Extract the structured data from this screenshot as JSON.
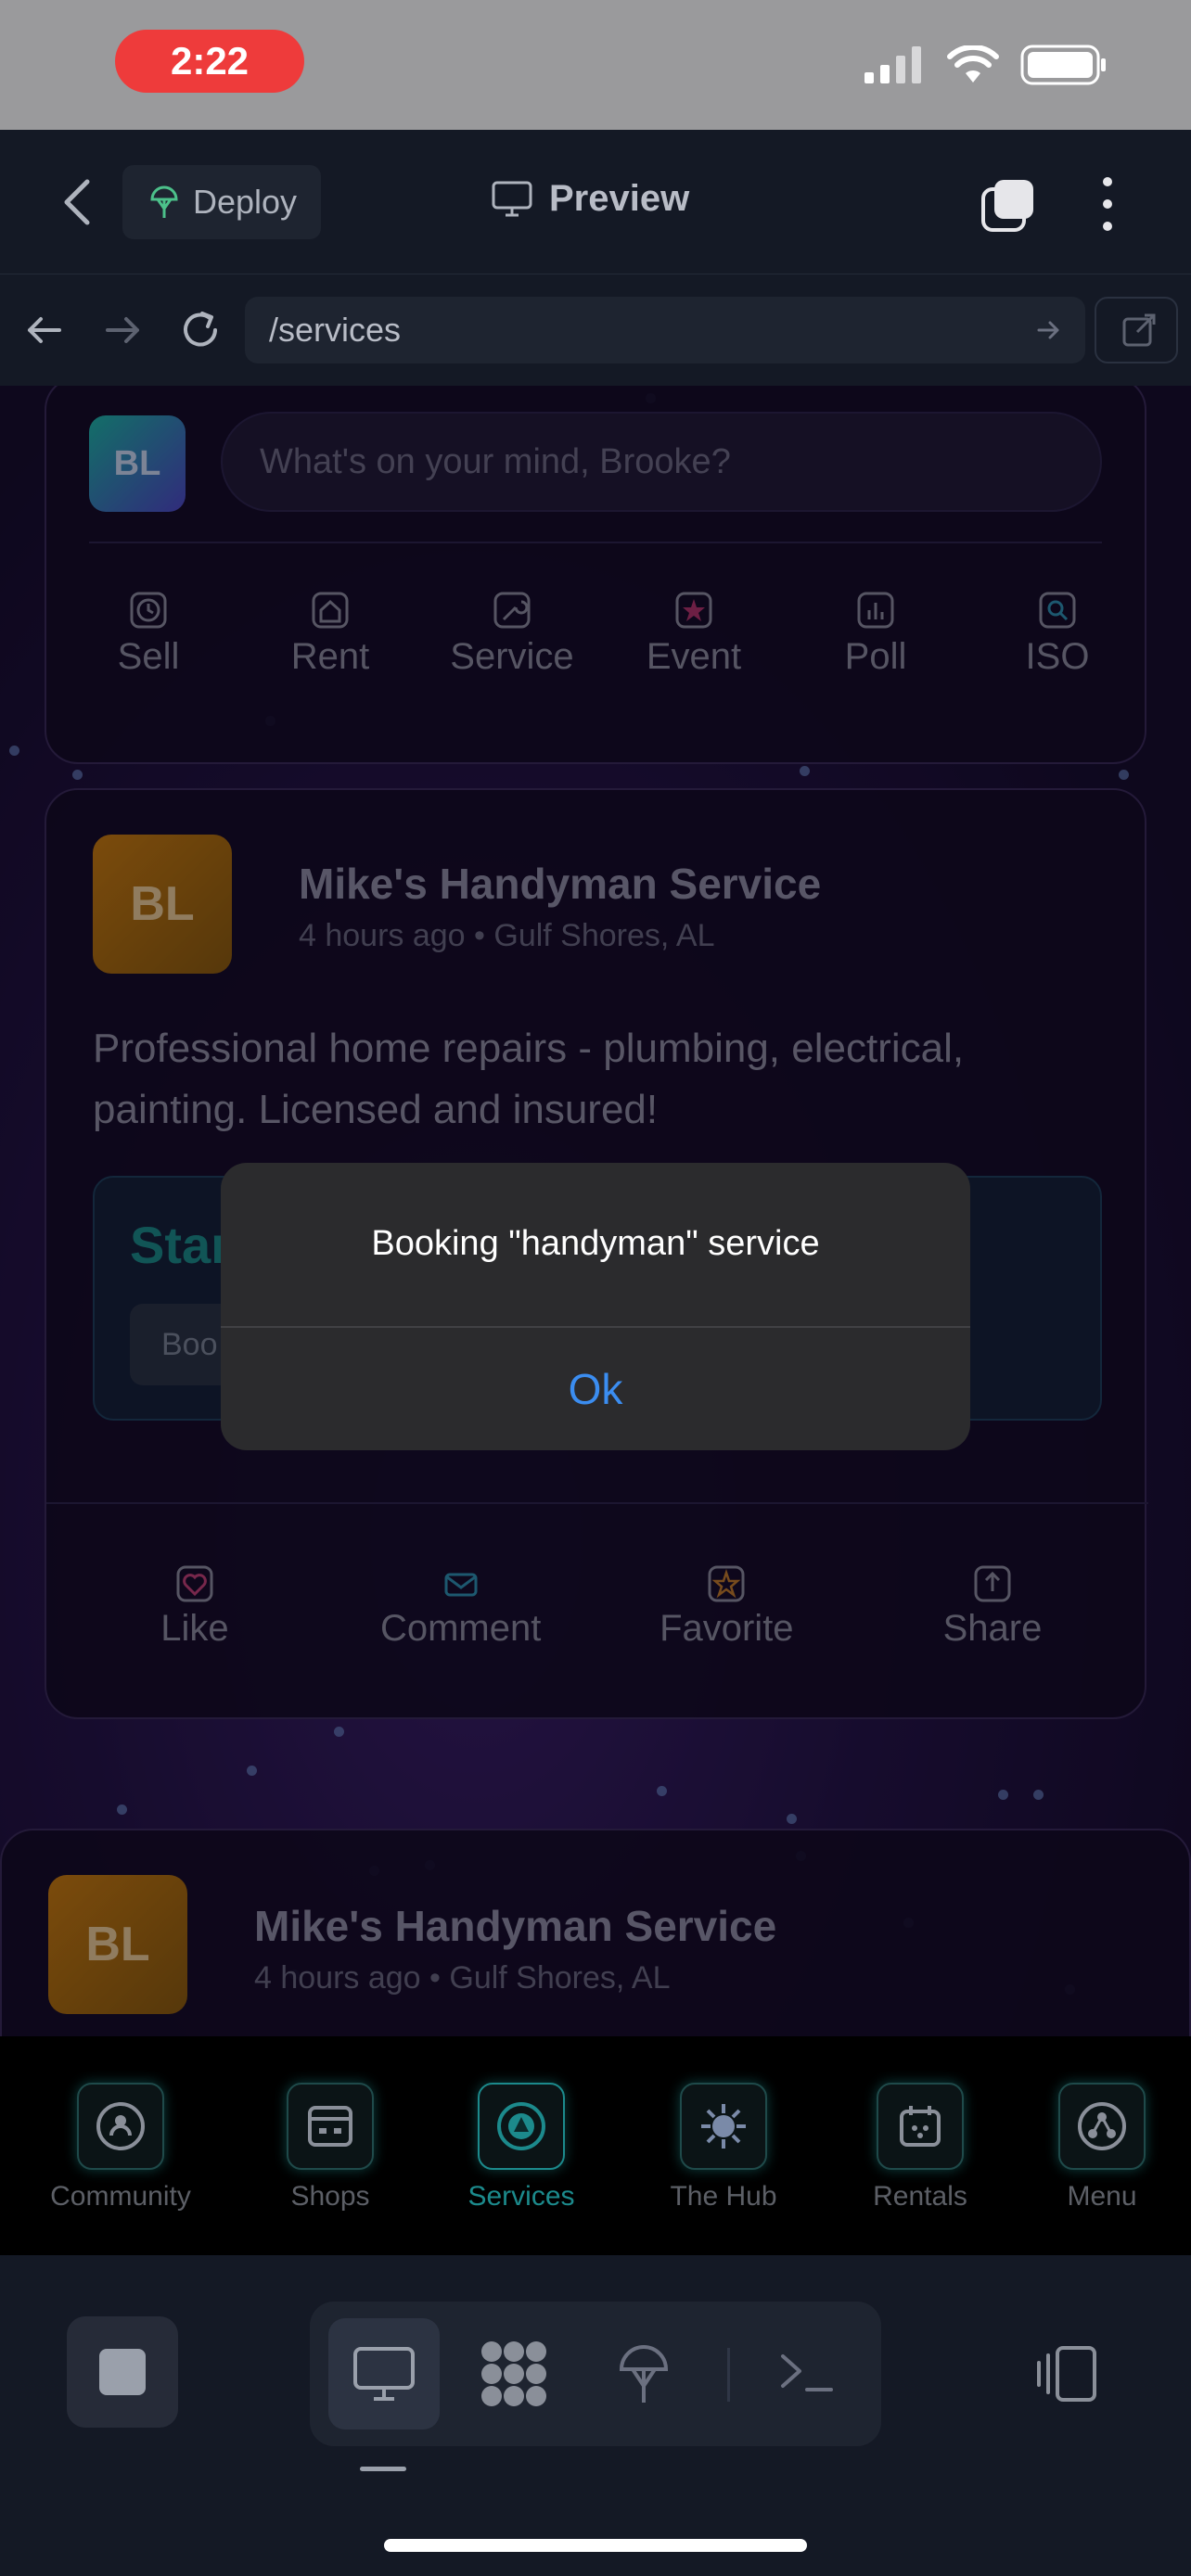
{
  "status_bar": {
    "time": "2:22"
  },
  "app_bar": {
    "deploy_label": "Deploy",
    "preview_label": "Preview"
  },
  "browser": {
    "url": "/services"
  },
  "composer": {
    "avatar_initials": "BL",
    "placeholder": "What's on your mind, Brooke?",
    "actions": [
      {
        "label": "Sell",
        "icon": "clock-icon"
      },
      {
        "label": "Rent",
        "icon": "home-icon"
      },
      {
        "label": "Service",
        "icon": "wrench-icon"
      },
      {
        "label": "Event",
        "icon": "star-icon"
      },
      {
        "label": "Poll",
        "icon": "bar-chart-icon"
      },
      {
        "label": "ISO",
        "icon": "search-icon"
      }
    ]
  },
  "post": {
    "avatar_initials": "BL",
    "name": "Mike's Handyman Service",
    "meta": "4 hours ago • Gulf Shores, AL",
    "body": "Professional home repairs - plumbing, electrical, painting. Licensed and insured!",
    "service_title": "Star",
    "service_button": "Boo",
    "reactions": [
      {
        "label": "Like",
        "icon": "heart-icon"
      },
      {
        "label": "Comment",
        "icon": "mail-icon"
      },
      {
        "label": "Favorite",
        "icon": "star-icon"
      },
      {
        "label": "Share",
        "icon": "share-icon"
      }
    ]
  },
  "post2": {
    "avatar_initials": "BL",
    "name": "Mike's Handyman Service",
    "meta": "4 hours ago • Gulf Shores, AL"
  },
  "tabbar": {
    "tabs": [
      {
        "label": "Community",
        "icon": "community-icon"
      },
      {
        "label": "Shops",
        "icon": "shop-icon"
      },
      {
        "label": "Services",
        "icon": "services-icon",
        "active": true
      },
      {
        "label": "The Hub",
        "icon": "hub-icon"
      },
      {
        "label": "Rentals",
        "icon": "rentals-icon"
      },
      {
        "label": "Menu",
        "icon": "menu-icon"
      }
    ]
  },
  "alert": {
    "message": "Booking \"handyman\" service",
    "ok_label": "Ok"
  },
  "colors": {
    "accent": "#1c8a8c",
    "alert_link": "#3b8df0",
    "time_pill": "#ee3b3b"
  }
}
